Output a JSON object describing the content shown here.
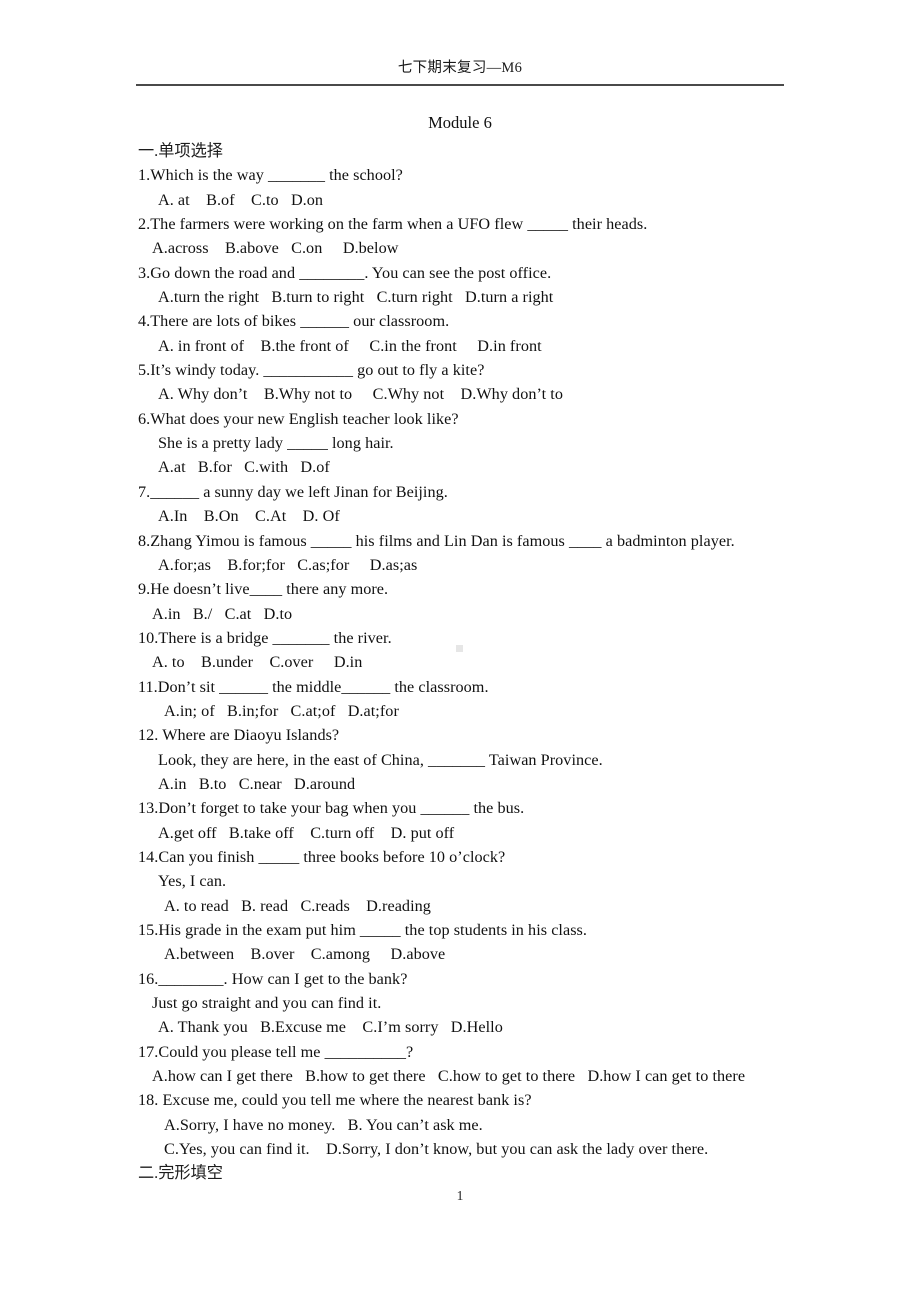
{
  "header": {
    "running_head": "七下期末复习—M6"
  },
  "title": "Module 6",
  "page_number": "1",
  "sections": [
    {
      "heading": "一.单项选择"
    },
    {
      "heading": "二.完形填空"
    }
  ],
  "questions": [
    {
      "stem": "1.Which is the way _______ the school?",
      "lines": [
        {
          "text": "A. at    B.of    C.to   D.on",
          "indent": "ind2"
        }
      ]
    },
    {
      "stem": "2.The farmers were working on the farm when a UFO flew _____ their heads.",
      "lines": [
        {
          "text": "A.across    B.above   C.on     D.below",
          "indent": "ind1"
        }
      ]
    },
    {
      "stem": "3.Go down the road and ________. You can see the post office.",
      "lines": [
        {
          "text": "A.turn the right   B.turn to right   C.turn right   D.turn a right",
          "indent": "ind2"
        }
      ]
    },
    {
      "stem": "4.There are lots of bikes ______ our classroom.",
      "lines": [
        {
          "text": "A. in front of    B.the front of     C.in the front     D.in front",
          "indent": "ind2"
        }
      ]
    },
    {
      "stem": "5.It’s windy today. ___________ go out to fly a kite?",
      "lines": [
        {
          "text": "A. Why don’t    B.Why not to     C.Why not    D.Why don’t to",
          "indent": "ind2"
        }
      ]
    },
    {
      "stem": "6.What does your new English teacher look like?",
      "lines": [
        {
          "text": "She is a pretty lady _____ long hair.",
          "indent": "ind2"
        },
        {
          "text": "A.at   B.for   C.with   D.of",
          "indent": "ind2"
        }
      ]
    },
    {
      "stem": "7.______ a sunny day we left Jinan for Beijing.",
      "lines": [
        {
          "text": "A.In    B.On    C.At    D. Of",
          "indent": "ind2"
        }
      ]
    },
    {
      "stem": "8.Zhang Yimou is famous _____ his films and Lin Dan is famous ____ a badminton player.",
      "lines": [
        {
          "text": "A.for;as    B.for;for   C.as;for     D.as;as",
          "indent": "ind2"
        }
      ]
    },
    {
      "stem": "9.He doesn’t live____ there any more.",
      "lines": [
        {
          "text": "A.in   B./   C.at   D.to",
          "indent": "ind1"
        }
      ]
    },
    {
      "stem": "10.There is a bridge _______ the river.",
      "lines": [
        {
          "text": "A. to    B.under    C.over     D.in",
          "indent": "ind1"
        }
      ]
    },
    {
      "stem": "11.Don’t sit ______ the middle______ the classroom.",
      "lines": [
        {
          "text": "A.in; of   B.in;for   C.at;of   D.at;for",
          "indent": "ind3"
        }
      ]
    },
    {
      "stem": "12. Where are Diaoyu Islands?",
      "lines": [
        {
          "text": "Look, they are here, in the east of China, _______ Taiwan Province.",
          "indent": "ind2"
        },
        {
          "text": "A.in   B.to   C.near   D.around",
          "indent": "ind2"
        }
      ]
    },
    {
      "stem": "13.Don’t forget to take your bag when you ______ the bus.",
      "lines": [
        {
          "text": "A.get off   B.take off    C.turn off    D. put off",
          "indent": "ind2"
        }
      ]
    },
    {
      "stem": "14.Can you finish _____ three books before 10 o’clock?",
      "lines": [
        {
          "text": "Yes, I can.",
          "indent": "ind2"
        },
        {
          "text": "A. to read   B. read   C.reads    D.reading",
          "indent": "ind3"
        }
      ]
    },
    {
      "stem": "15.His grade in the exam put him _____ the top students in his class.",
      "lines": [
        {
          "text": "A.between    B.over    C.among     D.above",
          "indent": "ind3"
        }
      ]
    },
    {
      "stem": "16.________. How can I get to the bank?",
      "lines": [
        {
          "text": "Just go straight and you can find it.",
          "indent": "ind1"
        },
        {
          "text": "A. Thank you   B.Excuse me    C.I’m sorry   D.Hello",
          "indent": "ind2"
        }
      ]
    },
    {
      "stem": "17.Could you please tell me __________?",
      "lines": [
        {
          "text": "A.how can I get there   B.how to get there   C.how to get to there   D.how I can get to there",
          "indent": "ind1"
        }
      ]
    },
    {
      "stem": "18. Excuse me, could you tell me where the nearest bank is?",
      "lines": [
        {
          "text": "A.Sorry, I have no money.   B. You can’t ask me.",
          "indent": "ind3"
        },
        {
          "text": "C.Yes, you can find it.    D.Sorry, I don’t know, but you can ask the lady over there.",
          "indent": "ind3"
        }
      ]
    }
  ]
}
